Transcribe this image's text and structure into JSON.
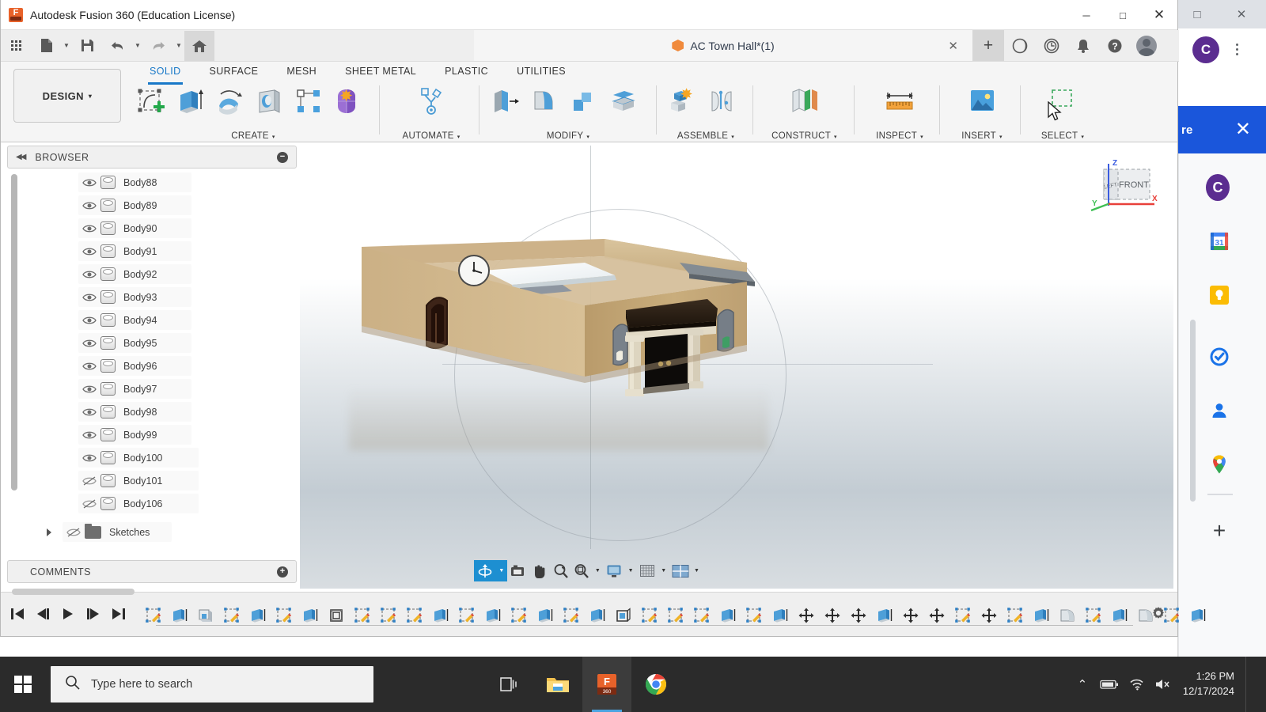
{
  "app": {
    "title": "Autodesk Fusion 360 (Education License)",
    "icon": "fusion-logo-icon",
    "window_controls": {
      "minimize": "─",
      "maximize": "□",
      "close": "✕"
    }
  },
  "quick_access": {
    "items": [
      {
        "name": "app-grid",
        "icon": "grid-icon"
      },
      {
        "name": "new-file",
        "icon": "file-icon",
        "has_caret": true
      },
      {
        "name": "save",
        "icon": "save-icon"
      },
      {
        "name": "undo",
        "icon": "undo-arrow-icon",
        "has_caret": true
      },
      {
        "name": "redo",
        "icon": "redo-arrow-icon",
        "has_caret": true
      },
      {
        "name": "home",
        "icon": "home-icon"
      }
    ]
  },
  "document_tab": {
    "label": "AC Town Hall*(1)",
    "icon": "orange-cube-icon",
    "close": "✕",
    "new_tab": "+"
  },
  "top_right_icons": [
    {
      "name": "extensions-icon",
      "glyph": "◔"
    },
    {
      "name": "job-status-clock-icon",
      "glyph": "◴"
    },
    {
      "name": "notifications-bell-icon",
      "glyph": "ὑ4"
    },
    {
      "name": "help-icon",
      "glyph": "?"
    },
    {
      "name": "user-avatar",
      "glyph": ""
    }
  ],
  "ribbon": {
    "workspace": "DESIGN",
    "workspace_caret": "▾",
    "tabs": [
      {
        "label": "SOLID",
        "active": true
      },
      {
        "label": "SURFACE",
        "active": false
      },
      {
        "label": "MESH",
        "active": false
      },
      {
        "label": "SHEET METAL",
        "active": false
      },
      {
        "label": "PLASTIC",
        "active": false
      },
      {
        "label": "UTILITIES",
        "active": false
      }
    ],
    "panels": [
      {
        "label": "CREATE",
        "caret": "▾",
        "tools": [
          "create-sketch-icon",
          "extrude-icon",
          "revolve-icon",
          "sweep-icon",
          "pattern-icon",
          "form-icon"
        ]
      },
      {
        "label": "AUTOMATE",
        "caret": "▾",
        "tools": [
          "automate-generative-icon"
        ]
      },
      {
        "label": "MODIFY",
        "caret": "▾",
        "tools": [
          "press-pull-icon",
          "fillet-icon",
          "shell-icon",
          "split-face-icon"
        ]
      },
      {
        "label": "ASSEMBLE",
        "caret": "▾",
        "tools": [
          "new-component-icon",
          "joint-icon"
        ]
      },
      {
        "label": "CONSTRUCT",
        "caret": "▾",
        "tools": [
          "offset-plane-icon"
        ]
      },
      {
        "label": "INSPECT",
        "caret": "▾",
        "tools": [
          "measure-icon"
        ]
      },
      {
        "label": "INSERT",
        "caret": "▾",
        "tools": [
          "insert-image-icon"
        ]
      },
      {
        "label": "SELECT",
        "caret": "▾",
        "tools": [
          "window-selection-icon"
        ]
      }
    ]
  },
  "browser": {
    "title": "BROWSER",
    "collapse_icon": "collapse-left-icon",
    "minus_button": "−",
    "items": [
      {
        "label": "Body88",
        "visible": true,
        "type": "body"
      },
      {
        "label": "Body89",
        "visible": true,
        "type": "body"
      },
      {
        "label": "Body90",
        "visible": true,
        "type": "body"
      },
      {
        "label": "Body91",
        "visible": true,
        "type": "body"
      },
      {
        "label": "Body92",
        "visible": true,
        "type": "body"
      },
      {
        "label": "Body93",
        "visible": true,
        "type": "body"
      },
      {
        "label": "Body94",
        "visible": true,
        "type": "body"
      },
      {
        "label": "Body95",
        "visible": true,
        "type": "body"
      },
      {
        "label": "Body96",
        "visible": true,
        "type": "body"
      },
      {
        "label": "Body97",
        "visible": true,
        "type": "body"
      },
      {
        "label": "Body98",
        "visible": true,
        "type": "body"
      },
      {
        "label": "Body99",
        "visible": true,
        "type": "body"
      },
      {
        "label": "Body100",
        "visible": true,
        "type": "body"
      },
      {
        "label": "Body101",
        "visible": false,
        "type": "body"
      },
      {
        "label": "Body106",
        "visible": false,
        "type": "body"
      },
      {
        "label": "Sketches",
        "visible": false,
        "type": "folder"
      }
    ]
  },
  "comments": {
    "title": "COMMENTS",
    "add_button": "+"
  },
  "viewcube": {
    "front_label": "FRONT",
    "left_label": "LEFT",
    "axes": {
      "x": "X",
      "y": "Y",
      "z": "Z"
    },
    "colors": {
      "x": "#e8403a",
      "y": "#3fbf54",
      "z": "#3b5ce0"
    }
  },
  "navbar": {
    "items": [
      {
        "name": "orbit-tool",
        "icon": "orbit-icon",
        "active": true,
        "caret": "▾"
      },
      {
        "name": "look-at-tool",
        "icon": "camera-icon",
        "active": false
      },
      {
        "name": "pan-tool",
        "icon": "hand-icon",
        "active": false
      },
      {
        "name": "zoom-tool",
        "icon": "magnifier-plus-icon",
        "active": false
      },
      {
        "name": "fit-tool",
        "icon": "magnifier-fit-icon",
        "active": false,
        "caret": "▾"
      },
      {
        "name": "display-settings",
        "icon": "monitor-icon",
        "active": false,
        "caret": "▾"
      },
      {
        "name": "grid-snaps",
        "icon": "grid-mesh-icon",
        "active": false,
        "caret": "▾"
      },
      {
        "name": "viewport-layout",
        "icon": "viewport-quad-icon",
        "active": false,
        "caret": "▾"
      }
    ]
  },
  "timeline": {
    "playback": [
      {
        "name": "go-to-beginning",
        "glyph": "⏮"
      },
      {
        "name": "step-back",
        "glyph": "◀❘"
      },
      {
        "name": "play",
        "glyph": "▶"
      },
      {
        "name": "step-forward",
        "glyph": "❘▶"
      },
      {
        "name": "go-to-end",
        "glyph": "⏭"
      }
    ],
    "settings_icon": "gear-icon",
    "features": [
      "sketch",
      "extrude",
      "shell",
      "sketch",
      "extrude",
      "sketch",
      "extrude",
      "shell-alt",
      "sketch",
      "sketch",
      "sketch",
      "extrude",
      "sketch",
      "extrude",
      "sketch",
      "extrude",
      "sketch",
      "extrude",
      "shell-box",
      "sketch",
      "sketch",
      "sketch",
      "extrude",
      "sketch",
      "extrude",
      "move",
      "move",
      "move",
      "extrude",
      "move",
      "move",
      "sketch",
      "move",
      "sketch",
      "extrude",
      "fillet",
      "sketch",
      "extrude",
      "fillet",
      "sketch",
      "extrude"
    ]
  },
  "model": {
    "name": "AC Town Hall building",
    "colors": {
      "wall_light": "#d4b98c",
      "wall_mid": "#c9ad7e",
      "wall_dark": "#b99d6e",
      "roof_dark": "#2b2118",
      "column": "#ded6c2",
      "door": "#0d0b09",
      "floor": "#e8eef2"
    }
  },
  "chrome_panel": {
    "avatar_letter": "C",
    "banner_text": "re",
    "banner_close": "✕",
    "banner_color": "#1a56db",
    "side_icons": [
      {
        "name": "chrome-profile-avatar",
        "letter": "C"
      },
      {
        "name": "google-calendar-icon"
      },
      {
        "name": "google-keep-icon"
      },
      {
        "name": "google-tasks-icon"
      },
      {
        "name": "google-contacts-icon"
      },
      {
        "name": "google-maps-icon"
      },
      {
        "name": "add-side-panel-icon",
        "glyph": "+"
      }
    ],
    "window_controls": {
      "maximize": "□",
      "close": "✕"
    }
  },
  "taskbar": {
    "start": "windows-logo-icon",
    "search_placeholder": "Type here to search",
    "search_icon": "magnifier-icon",
    "apps": [
      {
        "name": "task-view-icon",
        "active": false
      },
      {
        "name": "file-explorer-icon",
        "active": false
      },
      {
        "name": "fusion360-taskbar-icon",
        "active": true
      },
      {
        "name": "chrome-taskbar-icon",
        "active": false
      }
    ],
    "tray": [
      {
        "name": "show-hidden-icons",
        "glyph": "⌃"
      },
      {
        "name": "battery-icon"
      },
      {
        "name": "wifi-icon"
      },
      {
        "name": "volume-muted-icon"
      }
    ],
    "time": "1:26 PM",
    "date": "12/17/2024"
  }
}
